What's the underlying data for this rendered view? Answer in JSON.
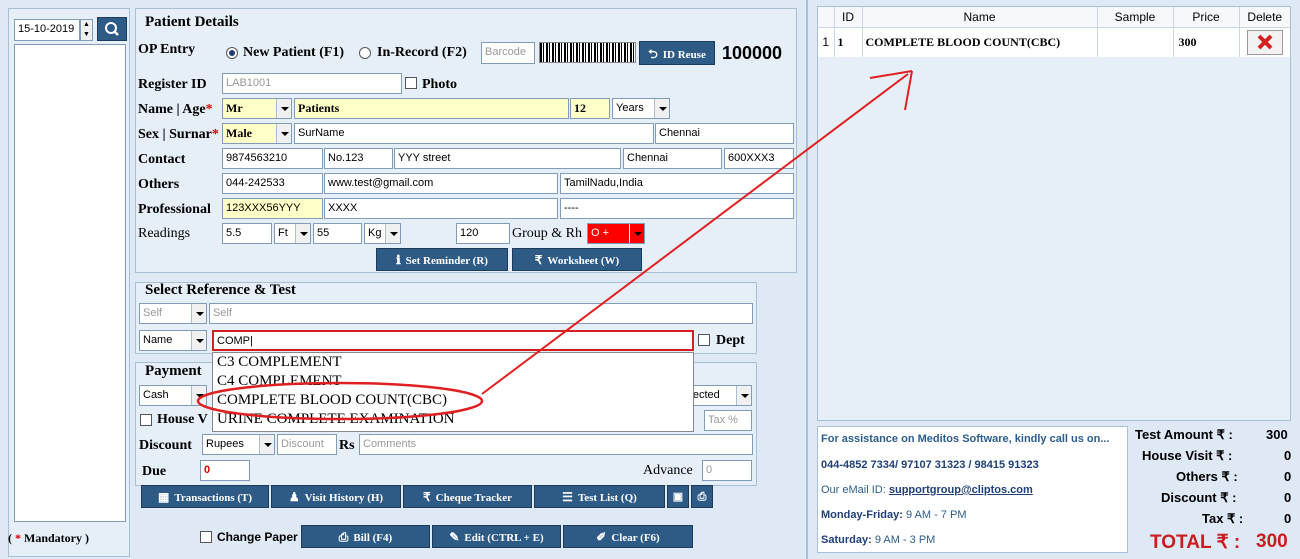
{
  "left": {
    "date": "15-10-2019"
  },
  "patient": {
    "title": "Patient Details",
    "op_entry_label": "OP Entry",
    "new_patient": "New Patient (F1)",
    "in_record": "In-Record (F2)",
    "barcode_placeholder": "Barcode",
    "id_reuse": "ID Reuse",
    "patient_no": "100000",
    "register_id_label": "Register ID",
    "register_id": "LAB1001",
    "photo_label": "Photo",
    "name_age_label": "Name | Age",
    "salutation": "Mr",
    "name": "Patients",
    "age": "12",
    "age_unit": "Years",
    "sex_label": "Sex | Surnar",
    "sex": "Male",
    "surname": "SurName",
    "city_top": "Chennai",
    "contact_label": "Contact",
    "phone": "9874563210",
    "door_no": "No.123",
    "street": "YYY street",
    "city": "Chennai",
    "pincode": "600XXX3",
    "others_label": "Others",
    "landline": "044-242533",
    "email": "www.test@gmail.com",
    "state": "TamilNadu,India",
    "professional_label": "Professional",
    "prof_id": "123XXX56YYY",
    "prof_name": "XXXX",
    "prof_extra": "----",
    "readings_label": "Readings",
    "height": "5.5",
    "height_unit": "Ft",
    "weight": "55",
    "weight_unit": "Kg",
    "bp": "120",
    "group_label": "Group & Rh",
    "blood_group": "O +",
    "set_reminder": "Set Reminder (R)",
    "worksheet": "Worksheet (W)"
  },
  "reference": {
    "title": "Select Reference & Test",
    "ref_type": "Self",
    "ref_name": "Self",
    "search_type": "Name",
    "search_value": "COMP",
    "dept_label": "Dept",
    "suggestions": [
      "C3 COMPLEMENT",
      "C4 COMPLEMENT",
      "COMPLETE BLOOD COUNT(CBC)",
      "URINE COMPLETE EXAMINATION"
    ]
  },
  "payment": {
    "title": "Payment",
    "mode": "Cash",
    "status": "llected",
    "house_visit_label": "House V",
    "tax_placeholder": "Tax %",
    "discount_label": "Discount",
    "discount_type": "Rupees",
    "discount_placeholder": "Discount",
    "rs_label": "Rs",
    "comments_placeholder": "Comments",
    "due_label": "Due",
    "due_value": "0",
    "advance_label": "Advance",
    "advance_value": "0"
  },
  "toolbar": {
    "transactions": "Transactions (T)",
    "visit_history": "Visit History (H)",
    "cheque_tracker": "Cheque Tracker",
    "test_list": "Test List (Q)"
  },
  "footer": {
    "mandatory": "Mandatory )",
    "mandatory_open": "(",
    "mandatory_star": "*",
    "change_paper": "Change Paper",
    "bill": "Bill (F4)",
    "edit": "Edit (CTRL + E)",
    "clear": "Clear (F6)"
  },
  "tests": {
    "headers": [
      "ID",
      "Name",
      "Sample",
      "Price",
      "Delete"
    ],
    "rows": [
      {
        "row": "1",
        "id": "1",
        "name": "COMPLETE BLOOD COUNT(CBC)",
        "sample": "",
        "price": "300"
      }
    ]
  },
  "assist": {
    "line1": "For assistance on Meditos Software, kindly call us on...",
    "phones": "044-4852 7334/ 97107 31323 / 98415 91323",
    "email_label": "Our eMail ID:",
    "email": "supportgroup@cliptos.com",
    "weekday_label": "Monday-Friday:",
    "weekday_time": "9 AM - 7 PM",
    "saturday_label": "Saturday:",
    "saturday_time": "9 AM - 3 PM"
  },
  "totals": {
    "test_amount_label": "Test Amount ₹ :",
    "test_amount": "300",
    "house_visit_label": "House Visit ₹ :",
    "house_visit": "0",
    "others_label": "Others ₹ :",
    "others": "0",
    "discount_label": "Discount ₹ :",
    "discount": "0",
    "tax_label": "Tax ₹ :",
    "tax": "0",
    "total_label": "TOTAL ₹ :",
    "total": "300"
  },
  "colors": {
    "button": "#2e5b86",
    "highlight": "#ffffc8",
    "annotation": "#e02020"
  }
}
